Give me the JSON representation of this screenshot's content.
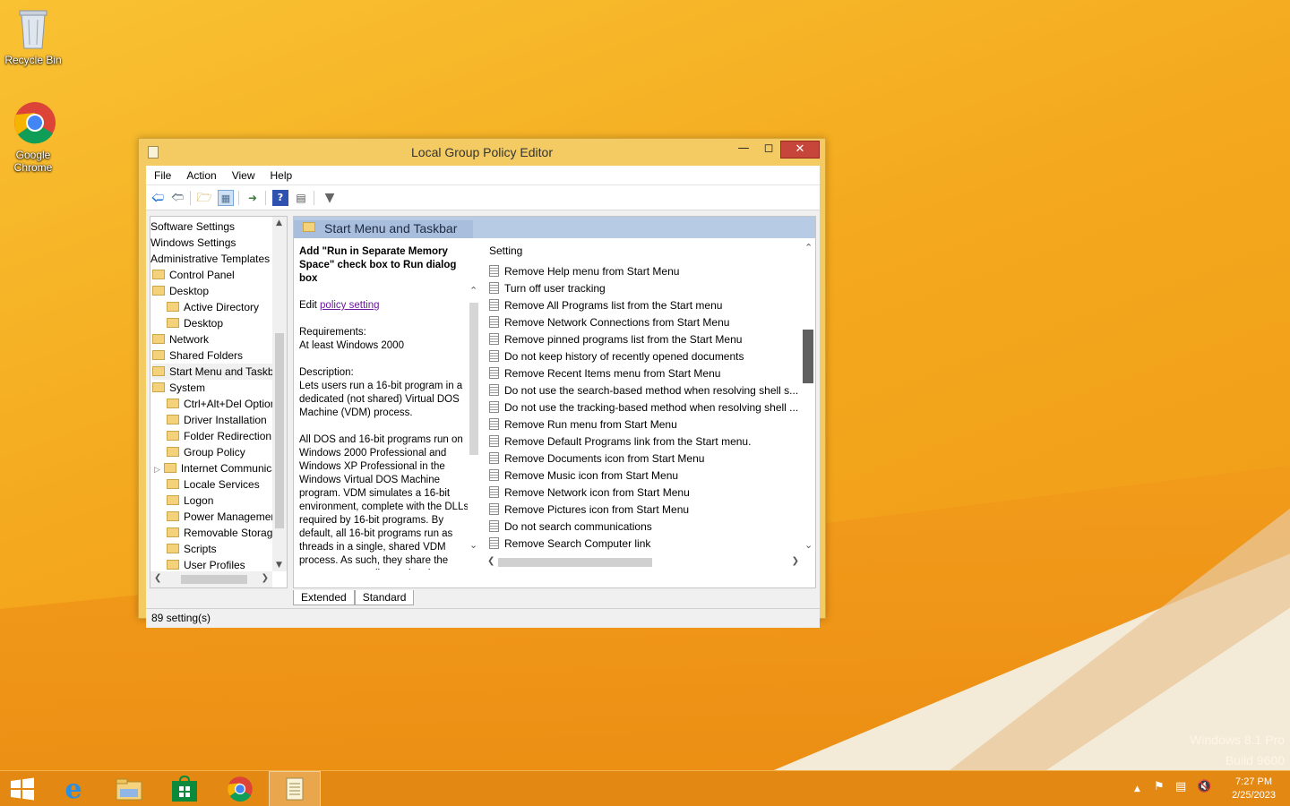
{
  "desktop": {
    "icons": [
      {
        "label": "Recycle Bin"
      },
      {
        "label": "Google Chrome"
      }
    ],
    "watermark": {
      "line1": "Windows 8.1 Pro",
      "line2": "Build 9600"
    }
  },
  "window": {
    "title": "Local Group Policy Editor",
    "menu": [
      "File",
      "Action",
      "View",
      "Help"
    ],
    "tree": [
      {
        "label": "Software Settings",
        "indent": 0,
        "folder": false
      },
      {
        "label": "Windows Settings",
        "indent": 0,
        "folder": false
      },
      {
        "label": "Administrative Templates",
        "indent": 0,
        "folder": false
      },
      {
        "label": "Control Panel",
        "indent": 1,
        "folder": true
      },
      {
        "label": "Desktop",
        "indent": 1,
        "folder": true
      },
      {
        "label": "Active Directory",
        "indent": 2,
        "folder": true
      },
      {
        "label": "Desktop",
        "indent": 2,
        "folder": true
      },
      {
        "label": "Network",
        "indent": 1,
        "folder": true
      },
      {
        "label": "Shared Folders",
        "indent": 1,
        "folder": true
      },
      {
        "label": "Start Menu and Taskbar",
        "indent": 1,
        "folder": true
      },
      {
        "label": "System",
        "indent": 1,
        "folder": true
      },
      {
        "label": "Ctrl+Alt+Del Options",
        "indent": 2,
        "folder": true
      },
      {
        "label": "Driver Installation",
        "indent": 2,
        "folder": true
      },
      {
        "label": "Folder Redirection",
        "indent": 2,
        "folder": true
      },
      {
        "label": "Group Policy",
        "indent": 2,
        "folder": true
      },
      {
        "label": "Internet Communication",
        "indent": 2,
        "folder": true
      },
      {
        "label": "Locale Services",
        "indent": 2,
        "folder": true
      },
      {
        "label": "Logon",
        "indent": 2,
        "folder": true
      },
      {
        "label": "Power Management",
        "indent": 2,
        "folder": true
      },
      {
        "label": "Removable Storage",
        "indent": 2,
        "folder": true
      },
      {
        "label": "Scripts",
        "indent": 2,
        "folder": true
      },
      {
        "label": "User Profiles",
        "indent": 2,
        "folder": true
      }
    ],
    "right_header": "Start Menu and Taskbar",
    "description": {
      "title": "Add \"Run in Separate Memory Space\" check box to Run dialog box",
      "edit_prefix": "Edit",
      "edit_link": "policy setting",
      "requirements_label": "Requirements:",
      "requirements_value": "At least Windows 2000",
      "description_label": "Description:",
      "para1": "Lets users run a 16-bit program in a dedicated (not shared) Virtual DOS Machine (VDM) process.",
      "para2": "All DOS and 16-bit programs run on Windows 2000 Professional and Windows XP Professional in the Windows Virtual DOS Machine program. VDM simulates a 16-bit environment, complete with the DLLs required by 16-bit programs. By default, all 16-bit programs run as threads in a single, shared VDM process. As such, they share the memory space allocated to the"
    },
    "list_header": "Setting",
    "settings": [
      "Remove Help menu from Start Menu",
      "Turn off user tracking",
      "Remove All Programs list from the Start menu",
      "Remove Network Connections from Start Menu",
      "Remove pinned programs list from the Start Menu",
      "Do not keep history of recently opened documents",
      "Remove Recent Items menu from Start Menu",
      "Do not use the search-based method when resolving shell s...",
      "Do not use the tracking-based method when resolving shell ...",
      "Remove Run menu from Start Menu",
      "Remove Default Programs link from the Start menu.",
      "Remove Documents icon from Start Menu",
      "Remove Music icon from Start Menu",
      "Remove Network icon from Start Menu",
      "Remove Pictures icon from Start Menu",
      "Do not search communications",
      "Remove Search Computer link"
    ],
    "tabs": [
      "Extended",
      "Standard"
    ],
    "status": "89 setting(s)"
  },
  "taskbar": {
    "time": "7:27 PM",
    "date": "2/25/2023"
  },
  "colors": {
    "title_bar": "#f3cb62",
    "close_button": "#c7463b",
    "taskbar": "#e38812",
    "pane_header": "#b8cbe4"
  }
}
